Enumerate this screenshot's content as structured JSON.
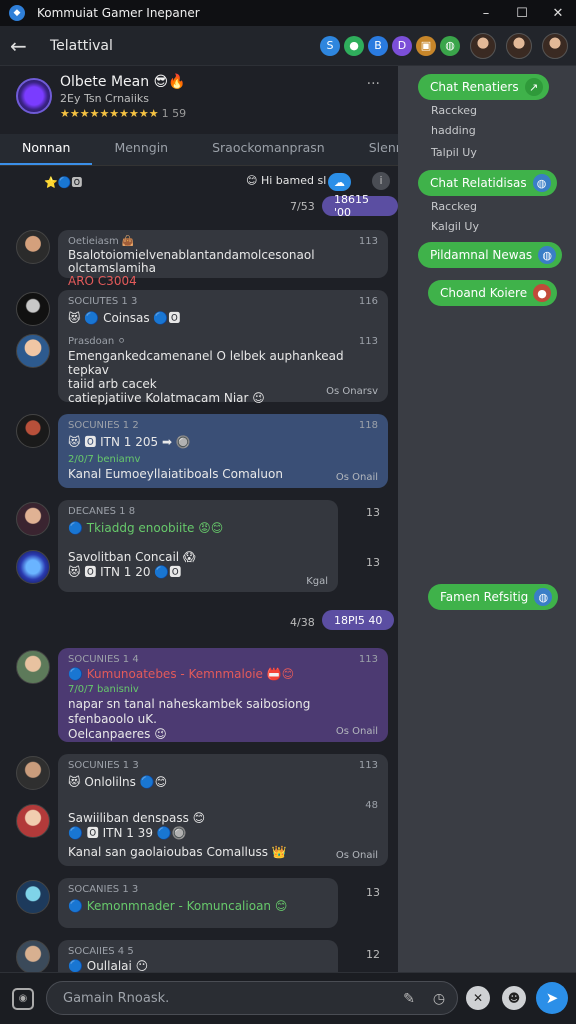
{
  "window": {
    "title": "Kommuiat Gamer Inepaner",
    "minimize": "–",
    "maximize": "☐",
    "close": "✕"
  },
  "header": {
    "back": "←",
    "title": "Telattival",
    "icons": [
      {
        "name": "s-icon",
        "glyph": "S",
        "color": "#2e86de"
      },
      {
        "name": "group-icon",
        "glyph": "●",
        "color": "#2fae5c"
      },
      {
        "name": "b-icon",
        "glyph": "B",
        "color": "#2a7be0"
      },
      {
        "name": "d-icon",
        "glyph": "D",
        "color": "#7b4fd8"
      },
      {
        "name": "treasure-icon",
        "glyph": "▣",
        "color": "#c7862a"
      },
      {
        "name": "globe-icon",
        "glyph": "◍",
        "color": "#3aa54a"
      }
    ]
  },
  "profile": {
    "name": "Olbete Mean 😎🔥",
    "sub": "2Ey Tsn Crnaiiks",
    "stars": "★★★★★★★★★★",
    "rating_count": "1 59",
    "more": "···"
  },
  "tabs": [
    "Nonnan",
    "Menngin",
    "Sraockomanprasn",
    "Slenny"
  ],
  "feed": {
    "top_left": "⭐🔵🅾",
    "top_right_text": "😊 Hi bamed sl",
    "top_right_badge": "☁",
    "chip1_left": "7/53",
    "chip1": "18615 '00",
    "messages": [
      {
        "meta": "Oetieiasm 👜",
        "time": "113",
        "lines": [
          "Bsalotoiomielvenablantandamolcesonaol olctamslamiha",
          "ARO C3004"
        ],
        "foot": ""
      },
      {
        "meta": "SOCIUTES 1 3",
        "time": "116",
        "lines": [
          "😻 🔵 Coinsas 🔵🅾"
        ],
        "foot": ""
      },
      {
        "meta": "Prasdoan ⚪",
        "time": "113",
        "lines": [
          "Emengankedcamenanel O lelbek auphankead tepkav",
          "taiid arb cacek",
          "catiepjatiive Kolatmacam Niar 😉"
        ],
        "foot": "Os Onarsv"
      },
      {
        "meta": "SOCUNIES 1 2",
        "time": "118",
        "lines": [
          "😻 🅾 ITN 1 205 ➡ 🔘",
          "2/0/7 beniamv",
          "Kanal Eumoeyllaiatiboals Comaluon"
        ],
        "foot": "Os Onail"
      },
      {
        "meta": "DECANES 1 8",
        "time": "13",
        "lines": [
          "🔵 Tkiaddg enoobiite 😡😊"
        ],
        "foot": ""
      },
      {
        "meta": "",
        "time": "13",
        "lines": [
          "Savolitban Concail 😱",
          "😻 🅾 ITN 1 20 🔵🅾"
        ],
        "foot": "Kgal"
      },
      {
        "meta": "SOCUNIES 1 4",
        "time": "113",
        "lines": [
          "🔵 Kumunoatebes - Kemnmaloie 📛😊",
          "7/0/7 banisniv",
          "napar sn tanal naheskambek saibosiong sfenbaoolo uK.",
          "Oelcanpaeres 😉"
        ],
        "foot": "Os Onail"
      },
      {
        "meta": "SOCUNIES 1 3",
        "time": "113",
        "lines": [
          "😻 Onlolilns 🔵😊"
        ],
        "foot": ""
      },
      {
        "meta": "",
        "time": "48",
        "lines": [
          "Sawiiliban denspass 😊",
          "🔵 🅾 ITN 1 39 🔵🔘",
          "Kanal san gaolaioubas Comalluss 👑"
        ],
        "foot": "Os Onail"
      },
      {
        "meta": "SOCANIES 1 3",
        "time": "13",
        "lines": [
          "🔵 Kemonmnader - Komuncalioan 😊"
        ],
        "foot": ""
      },
      {
        "meta": "SOCAIIES 4 5",
        "time": "12",
        "lines": [
          "🔵 Oullalai 😶"
        ],
        "foot": ""
      }
    ],
    "chip2_left": "4/38",
    "chip2": "18PI5 40"
  },
  "right": {
    "bubbles": [
      "Chat Renatiers",
      "Chat Relatidisas",
      "Pildamnal Newas",
      "Choand Koiere",
      "Famen Refsitig"
    ],
    "sub1": [
      "Racckeg",
      "hadding",
      "Talpil Uy"
    ],
    "sub2": [
      "Racckeg",
      "Kalgil Uy"
    ],
    "bubble_icons": [
      "↗",
      "◍",
      "◍",
      "●",
      "◍"
    ]
  },
  "composer": {
    "placeholder": "Gamain Rnoask.",
    "camera": "◉",
    "pencil": "✎",
    "clock": "◷",
    "game": "✕",
    "emoji": "☻",
    "send": "➤"
  },
  "colors": {
    "accent": "#2b8fe8",
    "bubble_green": "#3fb24a",
    "chip_purple": "#5b4ea2"
  }
}
